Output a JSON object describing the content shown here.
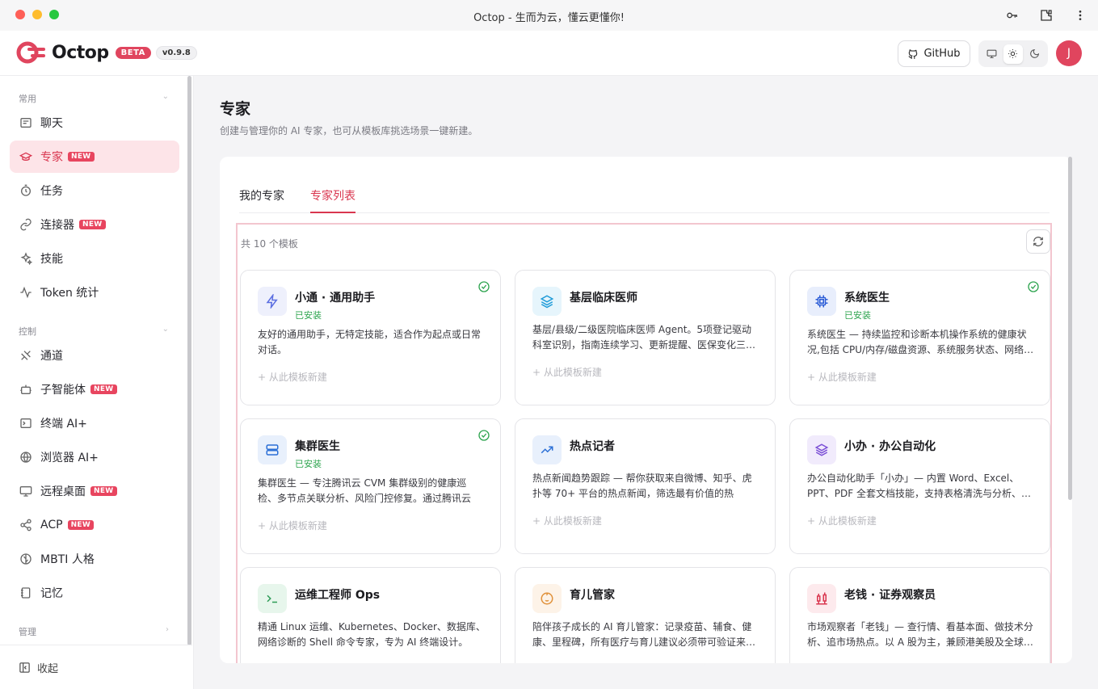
{
  "window": {
    "title": "Octop - 生而为云，懂云更懂你!"
  },
  "header": {
    "logo_text": "Octop",
    "beta_label": "BETA",
    "version": "v0.9.8",
    "github_label": "GitHub",
    "avatar_initial": "J",
    "brand_color": "#e0455e"
  },
  "sidebar": {
    "groups": [
      {
        "title": "常用"
      },
      {
        "title": "控制"
      },
      {
        "title": "管理"
      }
    ],
    "items": [
      {
        "label": "聊天",
        "icon": "chat-icon",
        "new": false
      },
      {
        "label": "专家",
        "icon": "graduation-cap-icon",
        "new": true,
        "active": true
      },
      {
        "label": "任务",
        "icon": "timer-icon",
        "new": false
      },
      {
        "label": "连接器",
        "icon": "link-icon",
        "new": true
      },
      {
        "label": "技能",
        "icon": "sparkles-icon",
        "new": false
      },
      {
        "label": "Token 统计",
        "icon": "activity-icon",
        "new": false
      },
      {
        "label": "通道",
        "icon": "channel-icon",
        "new": false
      },
      {
        "label": "子智能体",
        "icon": "bot-icon",
        "new": true
      },
      {
        "label": "终端 AI+",
        "icon": "terminal-icon",
        "new": false
      },
      {
        "label": "浏览器 AI+",
        "icon": "globe-icon",
        "new": false
      },
      {
        "label": "远程桌面",
        "icon": "monitor-icon",
        "new": true
      },
      {
        "label": "ACP",
        "icon": "share-icon",
        "new": true
      },
      {
        "label": "MBTI 人格",
        "icon": "brain-icon",
        "new": false
      },
      {
        "label": "记忆",
        "icon": "notebook-icon",
        "new": false
      }
    ],
    "new_label": "NEW",
    "collapse_label": "收起"
  },
  "main": {
    "title": "专家",
    "subtitle": "创建与管理你的 AI 专家，也可从模板库挑选场景一键新建。",
    "tabs": [
      {
        "label": "我的专家"
      },
      {
        "label": "专家列表",
        "active": true
      }
    ],
    "count_text": "共 10 个模板",
    "installed_label": "已安装",
    "action_label": "+ 从此模板新建",
    "cards": [
      {
        "name": "小通 · 通用助手",
        "installed": true,
        "icon": "lightning-icon",
        "icon_color": "#5b6ee1",
        "icon_bg": "#eef0fc",
        "desc": "友好的通用助手，无特定技能，适合作为起点或日常对话。"
      },
      {
        "name": "基层临床医师",
        "installed": false,
        "icon": "layers-icon",
        "icon_color": "#1f9bd8",
        "icon_bg": "#e6f5fc",
        "desc": "基层/县级/二级医院临床医师 Agent。5项登记驱动科室识别，指南连续学习、更新提醒、医保变化三…"
      },
      {
        "name": "系统医生",
        "installed": true,
        "icon": "cpu-icon",
        "icon_color": "#2b5cd6",
        "icon_bg": "#e8eefc",
        "desc": "系统医生 — 持续监控和诊断本机操作系统的健康状况,包括 CPU/内存/磁盘资源、系统服务状态、网络…"
      },
      {
        "name": "集群医生",
        "installed": true,
        "icon": "server-icon",
        "icon_color": "#2b6fd6",
        "icon_bg": "#e8f0fc",
        "desc": "集群医生 — 专注腾讯云 CVM 集群级别的健康巡检、多节点关联分析、风险门控修复。通过腾讯云 TAT…"
      },
      {
        "name": "热点记者",
        "installed": false,
        "icon": "trending-icon",
        "icon_color": "#2b6fd6",
        "icon_bg": "#e8f0fc",
        "desc": "热点新闻趋势跟踪 — 帮你获取来自微博、知乎、虎扑等 70+ 平台的热点新闻，筛选最有价值的热点，…"
      },
      {
        "name": "小办 · 办公自动化",
        "installed": false,
        "icon": "stack-icon",
        "icon_color": "#7b4fd6",
        "icon_bg": "#f1ebfc",
        "desc": "办公自动化助手「小办」— 内置 Word、Excel、PPT、PDF 全套文档技能，支持表格清洗与分析、…"
      },
      {
        "name": "运维工程师 Ops",
        "installed": false,
        "icon": "terminal-prompt-icon",
        "icon_color": "#2e9b57",
        "icon_bg": "#e7f6ec",
        "desc": "精通 Linux 运维、Kubernetes、Docker、数据库、网络诊断的 Shell 命令专家，专为 AI 终端设计。"
      },
      {
        "name": "育儿管家",
        "installed": false,
        "icon": "baby-icon",
        "icon_color": "#e0913a",
        "icon_bg": "#fdf3e8",
        "desc": "陪伴孩子成长的 AI 育儿管家：记录疫苗、辅食、健康、里程碑，所有医疗与育儿建议必须带可验证来…"
      },
      {
        "name": "老钱 · 证券观察员",
        "installed": false,
        "icon": "candlestick-icon",
        "icon_color": "#d9364f",
        "icon_bg": "#fdeaed",
        "desc": "市场观察者「老钱」— 查行情、看基本面、做技术分析、追市场热点。以 A 股为主，兼顾港美股及全球…"
      }
    ]
  }
}
